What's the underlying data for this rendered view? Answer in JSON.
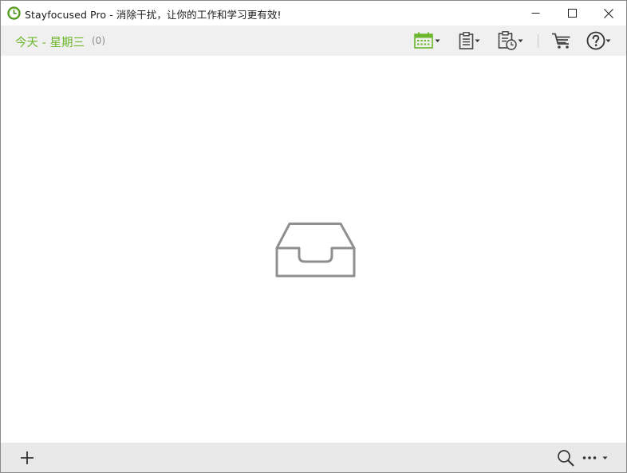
{
  "window": {
    "title": "Stayfocused Pro - 消除干扰，让你的工作和学习更有效!",
    "app_icon": "stayfocused-clock-icon",
    "controls": [
      "minimize-icon",
      "maximize-icon",
      "close-icon"
    ]
  },
  "toolbar": {
    "day_title": "今天 - 星期三",
    "day_count": "(0)",
    "buttons": [
      {
        "name": "calendar-button",
        "icon": "calendar-icon",
        "has_dropdown": true
      },
      {
        "name": "task-list-button",
        "icon": "clipboard-icon",
        "has_dropdown": true
      },
      {
        "name": "schedule-button",
        "icon": "clipboard-clock-icon",
        "has_dropdown": true
      },
      {
        "name": "cart-button",
        "icon": "shopping-cart-icon",
        "has_dropdown": false
      },
      {
        "name": "help-button",
        "icon": "help-icon",
        "has_dropdown": true
      }
    ]
  },
  "content": {
    "empty_state_icon": "empty-inbox-icon"
  },
  "bottom_bar": {
    "add_icon": "plus-icon",
    "search_icon": "search-icon",
    "more_icon": "more-icon"
  },
  "colors": {
    "accent": "#6cb72b",
    "toolbar_bg": "#f0f0f0",
    "bottom_bg": "#e9e9e9",
    "icon_gray": "#444444",
    "empty_icon_gray": "#8f8f8f",
    "count_text": "#8c8c8c"
  }
}
